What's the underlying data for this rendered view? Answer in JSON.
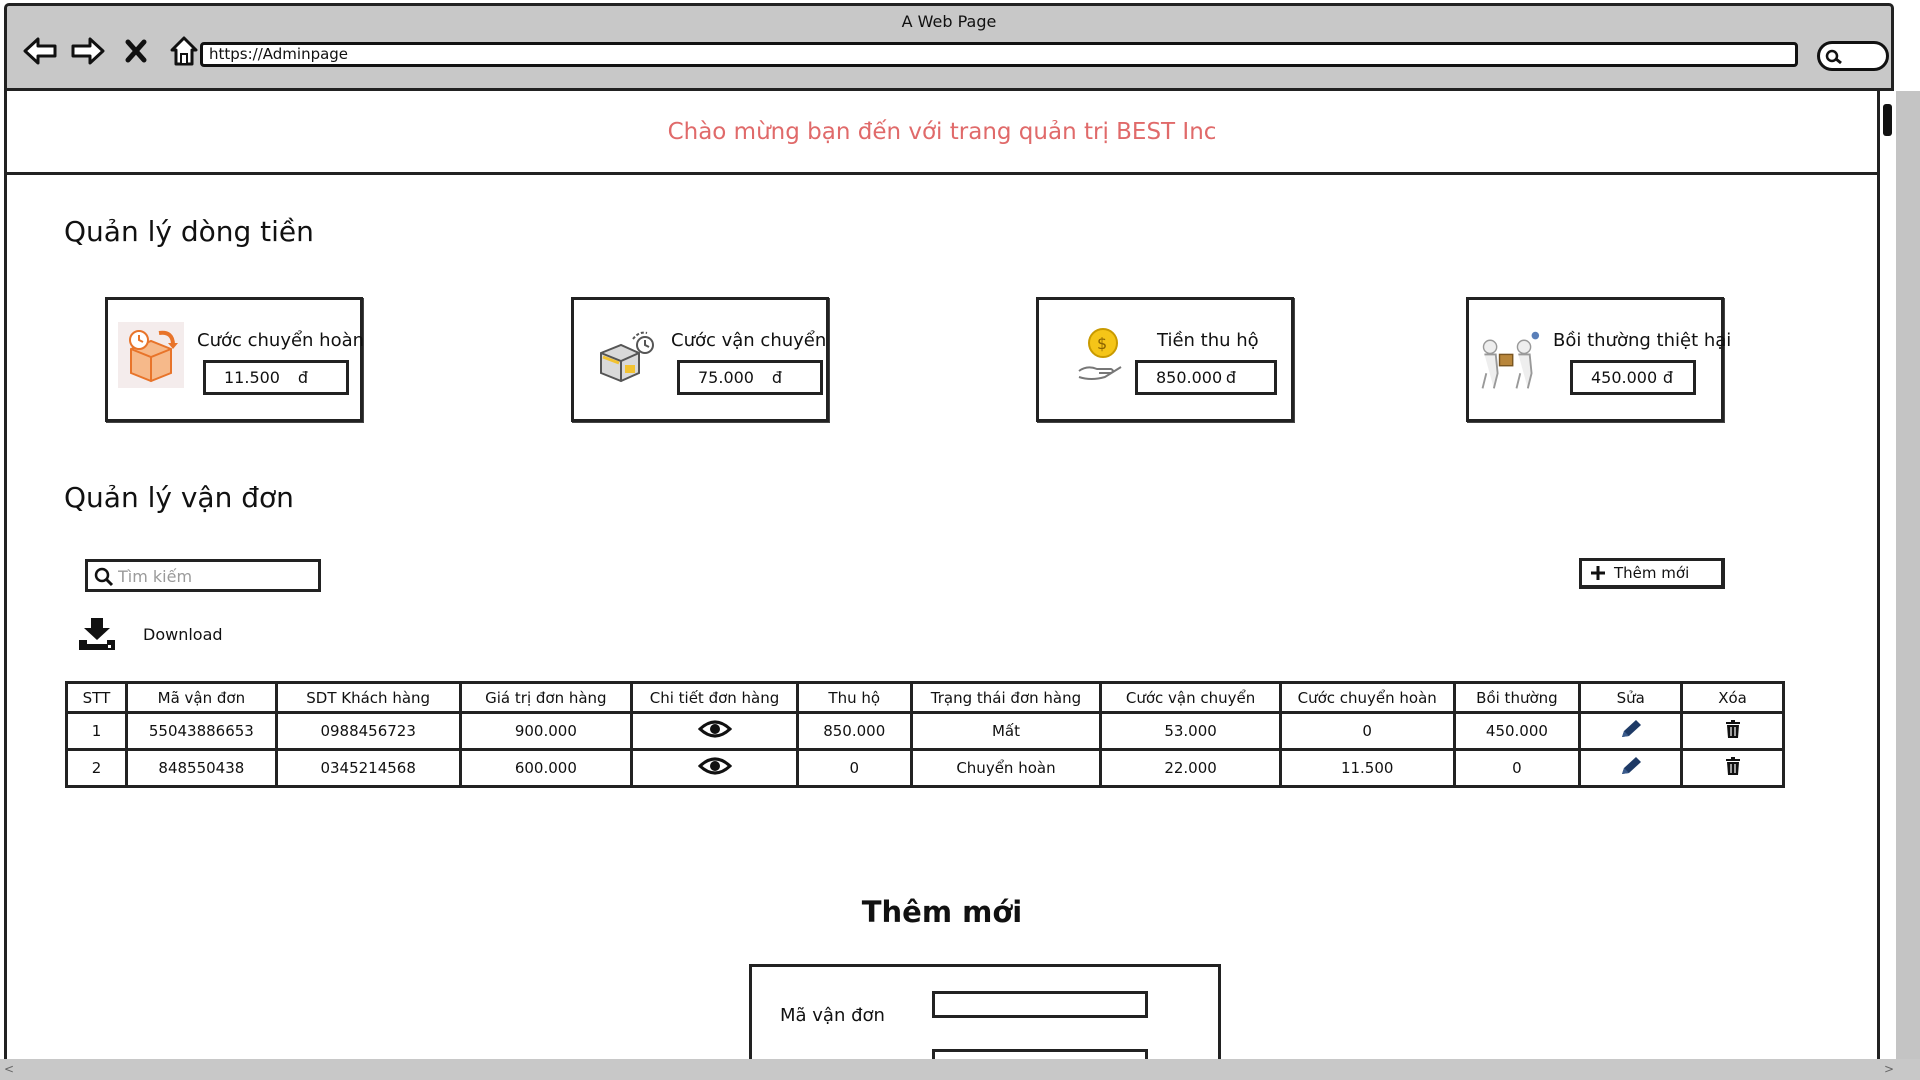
{
  "window": {
    "title": "A Web Page",
    "url": "https://Adminpage"
  },
  "banner": {
    "text": "Chào mừng bạn đến với trang quản trị BEST Inc",
    "color": "#e06a6a"
  },
  "cashflow": {
    "title": "Quản lý dòng tiền",
    "cards": [
      {
        "label": "Cước chuyển hoàn",
        "value": "11.500",
        "currency": "đ",
        "icon": "return-box-icon"
      },
      {
        "label": "Cước vận chuyển",
        "value": "75.000",
        "currency": "đ",
        "icon": "shipping-box-icon"
      },
      {
        "label": "Tiền thu hộ",
        "value": "850.000",
        "currency": "đ",
        "icon": "coin-hand-icon"
      },
      {
        "label": "Bồi thường thiệt hại",
        "value": "450.000",
        "currency": "đ",
        "icon": "compensation-icon"
      }
    ]
  },
  "orders": {
    "title": "Quản lý vận đơn",
    "search_placeholder": "Tìm kiếm",
    "add_label": "Thêm mới",
    "download_label": "Download",
    "columns": [
      "STT",
      "Mã vận đơn",
      "SDT Khách hàng",
      "Giá trị đơn hàng",
      "Chi tiết đơn hàng",
      "Thu hộ",
      "Trạng thái đơn hàng",
      "Cước vận chuyển",
      "Cước chuyển hoàn",
      "Bồi thường",
      "Sửa",
      "Xóa"
    ],
    "rows": [
      {
        "stt": "1",
        "code": "55043886653",
        "phone": "0988456723",
        "value": "900.000",
        "cod": "850.000",
        "status": "Mất",
        "shipping": "53.000",
        "return_fee": "0",
        "compensation": "450.000"
      },
      {
        "stt": "2",
        "code": "848550438",
        "phone": "0345214568",
        "value": "600.000",
        "cod": "0",
        "status": "Chuyển hoàn",
        "shipping": "22.000",
        "return_fee": "11.500",
        "compensation": "0"
      }
    ]
  },
  "form": {
    "title": "Thêm mới",
    "field1_label": "Mã vận đơn"
  }
}
